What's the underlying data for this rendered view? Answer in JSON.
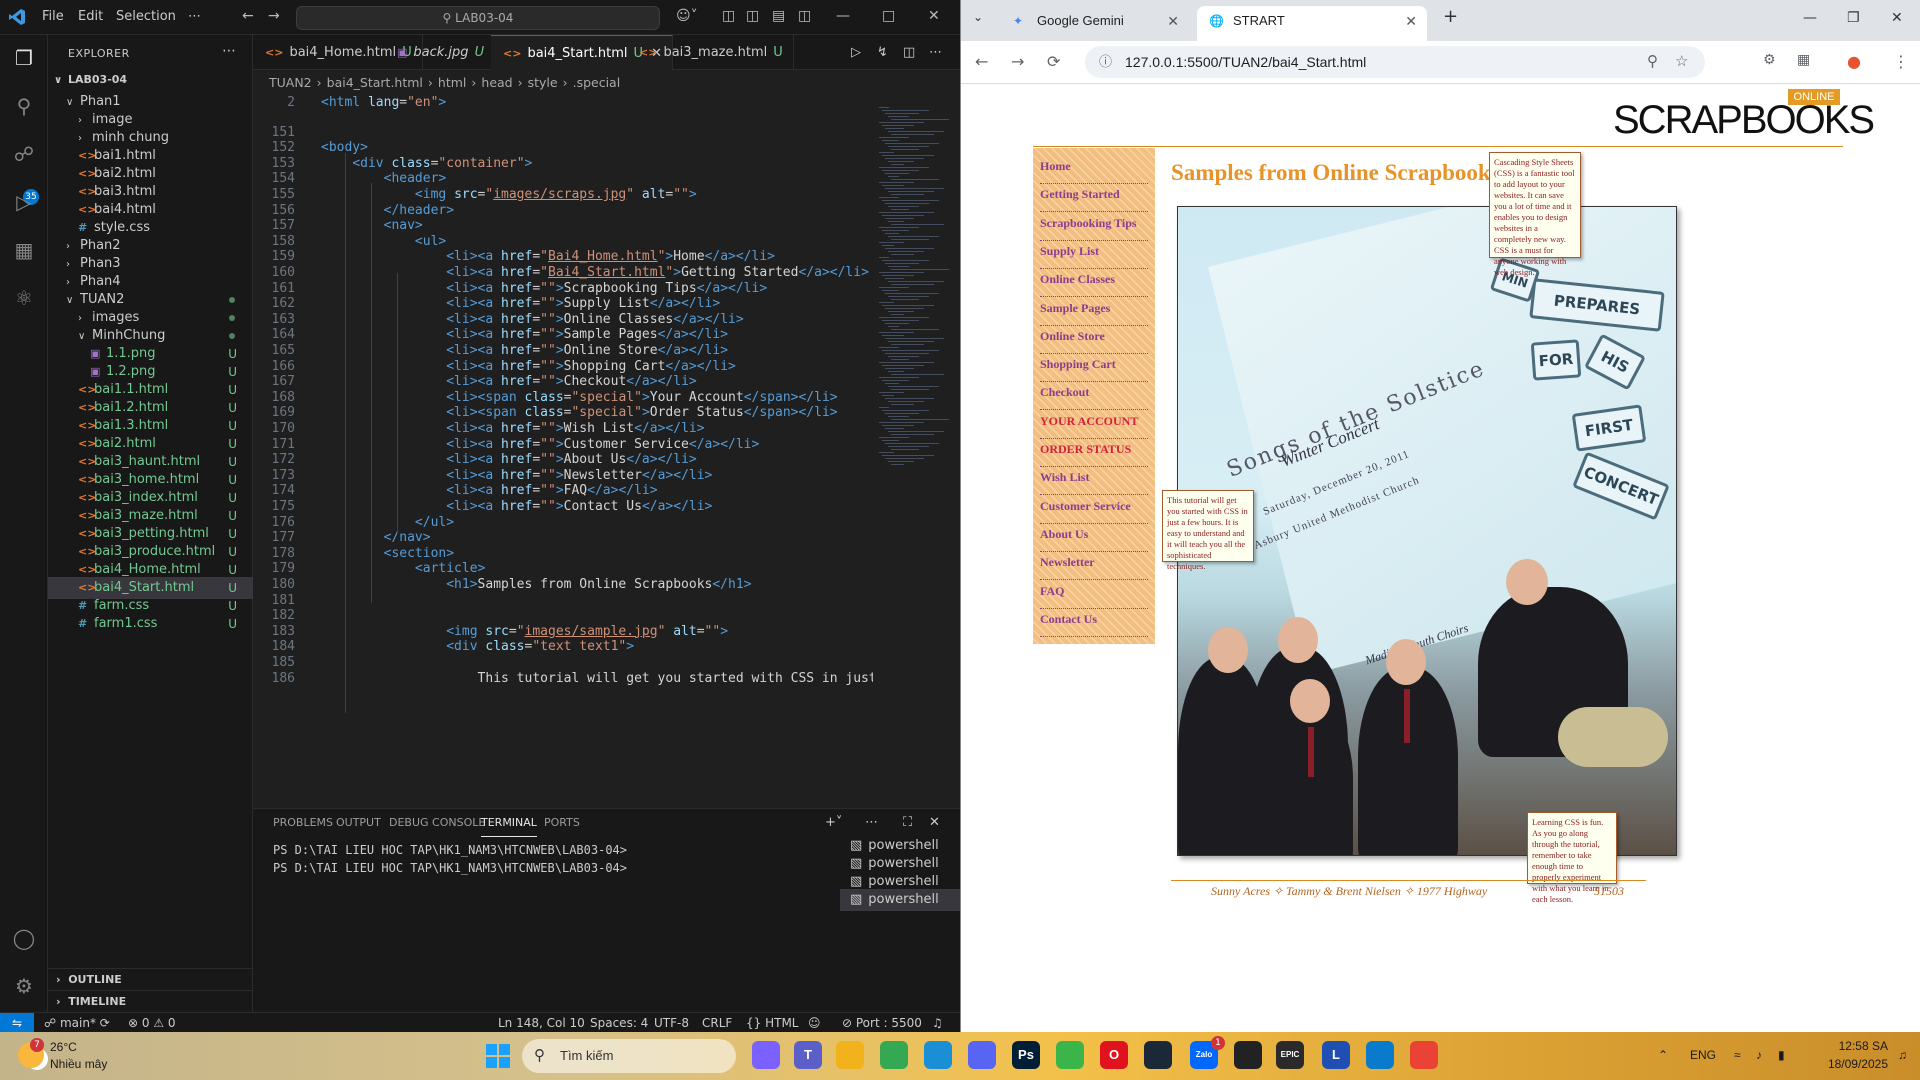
{
  "vscode": {
    "menu": [
      "File",
      "Edit",
      "Selection",
      "⋯"
    ],
    "command_center": "LAB03-04",
    "explorer": {
      "title": "EXPLORER",
      "root": "LAB03-04",
      "items": [
        {
          "label": "Phan1",
          "type": "folder-open",
          "indent": 1,
          "status": ""
        },
        {
          "label": "image",
          "type": "folder",
          "indent": 2,
          "status": ""
        },
        {
          "label": "minh chung",
          "type": "folder",
          "indent": 2,
          "status": ""
        },
        {
          "label": "bai1.html",
          "type": "html",
          "indent": 2,
          "status": ""
        },
        {
          "label": "bai2.html",
          "type": "html",
          "indent": 2,
          "status": ""
        },
        {
          "label": "bai3.html",
          "type": "html",
          "indent": 2,
          "status": ""
        },
        {
          "label": "bai4.html",
          "type": "html",
          "indent": 2,
          "status": ""
        },
        {
          "label": "style.css",
          "type": "css",
          "indent": 2,
          "status": ""
        },
        {
          "label": "Phan2",
          "type": "folder",
          "indent": 1,
          "status": ""
        },
        {
          "label": "Phan3",
          "type": "folder",
          "indent": 1,
          "status": ""
        },
        {
          "label": "Phan4",
          "type": "folder",
          "indent": 1,
          "status": ""
        },
        {
          "label": "TUAN2",
          "type": "folder-open",
          "indent": 1,
          "status": "dot"
        },
        {
          "label": "images",
          "type": "folder",
          "indent": 2,
          "status": "dot"
        },
        {
          "label": "MinhChung",
          "type": "folder-open",
          "indent": 2,
          "status": "dot"
        },
        {
          "label": "1.1.png",
          "type": "png",
          "indent": 3,
          "status": "U"
        },
        {
          "label": "1.2.png",
          "type": "png",
          "indent": 3,
          "status": "U"
        },
        {
          "label": "bai1.1.html",
          "type": "html",
          "indent": 2,
          "status": "U"
        },
        {
          "label": "bai1.2.html",
          "type": "html",
          "indent": 2,
          "status": "U"
        },
        {
          "label": "bai1.3.html",
          "type": "html",
          "indent": 2,
          "status": "U"
        },
        {
          "label": "bai2.html",
          "type": "html",
          "indent": 2,
          "status": "U"
        },
        {
          "label": "bai3_haunt.html",
          "type": "html",
          "indent": 2,
          "status": "U"
        },
        {
          "label": "bai3_home.html",
          "type": "html",
          "indent": 2,
          "status": "U"
        },
        {
          "label": "bai3_index.html",
          "type": "html",
          "indent": 2,
          "status": "U"
        },
        {
          "label": "bai3_maze.html",
          "type": "html",
          "indent": 2,
          "status": "U"
        },
        {
          "label": "bai3_petting.html",
          "type": "html",
          "indent": 2,
          "status": "U"
        },
        {
          "label": "bai3_produce.html",
          "type": "html",
          "indent": 2,
          "status": "U"
        },
        {
          "label": "bai4_Home.html",
          "type": "html",
          "indent": 2,
          "status": "U"
        },
        {
          "label": "bai4_Start.html",
          "type": "html",
          "indent": 2,
          "status": "U",
          "selected": true
        },
        {
          "label": "farm.css",
          "type": "css",
          "indent": 2,
          "status": "U"
        },
        {
          "label": "farm1.css",
          "type": "css",
          "indent": 2,
          "status": "U"
        }
      ],
      "outline": "OUTLINE",
      "timeline": "TIMELINE"
    },
    "tabs": [
      {
        "label": "bai4_Home.html",
        "type": "html",
        "status": "U",
        "italic": false,
        "active": false
      },
      {
        "label": "back.jpg",
        "type": "img",
        "status": "U",
        "italic": true,
        "active": false
      },
      {
        "label": "bai4_Start.html",
        "type": "html",
        "status": "U",
        "italic": false,
        "active": true
      },
      {
        "label": "bai3_maze.html",
        "type": "html",
        "status": "U",
        "italic": false,
        "active": false
      }
    ],
    "breadcrumb": [
      "TUAN2",
      "bai4_Start.html",
      "html",
      "head",
      "style",
      ".special"
    ],
    "code": [
      {
        "n": "2",
        "html": "<span class='tag'>&lt;html</span> <span class='attr'>lang</span>=<span class='str'>\"en\"</span><span class='tag'>&gt;</span>"
      },
      {
        "n": "151",
        "html": ""
      },
      {
        "n": "152",
        "html": "<span class='tag'>&lt;body&gt;</span>"
      },
      {
        "n": "153",
        "html": "    <span class='tag'>&lt;div</span> <span class='attr'>class</span>=<span class='str'>\"container\"</span><span class='tag'>&gt;</span>"
      },
      {
        "n": "154",
        "html": "        <span class='tag'>&lt;header&gt;</span>"
      },
      {
        "n": "155",
        "html": "            <span class='tag'>&lt;img</span> <span class='attr'>src</span>=<span class='str'>\"<u>images/scraps.jpg</u>\"</span> <span class='attr'>alt</span>=<span class='str'>\"\"</span><span class='tag'>&gt;</span>"
      },
      {
        "n": "156",
        "html": "        <span class='tag'>&lt;/header&gt;</span>"
      },
      {
        "n": "157",
        "html": "        <span class='tag'>&lt;nav&gt;</span>"
      },
      {
        "n": "158",
        "html": "            <span class='tag'>&lt;ul&gt;</span>"
      },
      {
        "n": "159",
        "html": "                <span class='tag'>&lt;li&gt;&lt;a</span> <span class='attr'>href</span>=<span class='str'>\"<u>Bai4_Home.html</u>\"</span><span class='tag'>&gt;</span><span class='txt'>Home</span><span class='tag'>&lt;/a&gt;&lt;/li&gt;</span>"
      },
      {
        "n": "160",
        "html": "                <span class='tag'>&lt;li&gt;&lt;a</span> <span class='attr'>href</span>=<span class='str'>\"<u>Bai4_Start.html</u>\"</span><span class='tag'>&gt;</span><span class='txt'>Getting Started</span><span class='tag'>&lt;/a&gt;&lt;/li&gt;</span>"
      },
      {
        "n": "161",
        "html": "                <span class='tag'>&lt;li&gt;&lt;a</span> <span class='attr'>href</span>=<span class='str'>\"\"</span><span class='tag'>&gt;</span><span class='txt'>Scrapbooking Tips</span><span class='tag'>&lt;/a&gt;&lt;/li&gt;</span>"
      },
      {
        "n": "162",
        "html": "                <span class='tag'>&lt;li&gt;&lt;a</span> <span class='attr'>href</span>=<span class='str'>\"\"</span><span class='tag'>&gt;</span><span class='txt'>Supply List</span><span class='tag'>&lt;/a&gt;&lt;/li&gt;</span>"
      },
      {
        "n": "163",
        "html": "                <span class='tag'>&lt;li&gt;&lt;a</span> <span class='attr'>href</span>=<span class='str'>\"\"</span><span class='tag'>&gt;</span><span class='txt'>Online Classes</span><span class='tag'>&lt;/a&gt;&lt;/li&gt;</span>"
      },
      {
        "n": "164",
        "html": "                <span class='tag'>&lt;li&gt;&lt;a</span> <span class='attr'>href</span>=<span class='str'>\"\"</span><span class='tag'>&gt;</span><span class='txt'>Sample Pages</span><span class='tag'>&lt;/a&gt;&lt;/li&gt;</span>"
      },
      {
        "n": "165",
        "html": "                <span class='tag'>&lt;li&gt;&lt;a</span> <span class='attr'>href</span>=<span class='str'>\"\"</span><span class='tag'>&gt;</span><span class='txt'>Online Store</span><span class='tag'>&lt;/a&gt;&lt;/li&gt;</span>"
      },
      {
        "n": "166",
        "html": "                <span class='tag'>&lt;li&gt;&lt;a</span> <span class='attr'>href</span>=<span class='str'>\"\"</span><span class='tag'>&gt;</span><span class='txt'>Shopping Cart</span><span class='tag'>&lt;/a&gt;&lt;/li&gt;</span>"
      },
      {
        "n": "167",
        "html": "                <span class='tag'>&lt;li&gt;&lt;a</span> <span class='attr'>href</span>=<span class='str'>\"\"</span><span class='tag'>&gt;</span><span class='txt'>Checkout</span><span class='tag'>&lt;/a&gt;&lt;/li&gt;</span>"
      },
      {
        "n": "168",
        "html": "                <span class='tag'>&lt;li&gt;&lt;span</span> <span class='attr'>class</span>=<span class='str'>\"special\"</span><span class='tag'>&gt;</span><span class='txt'>Your Account</span><span class='tag'>&lt;/span&gt;&lt;/li&gt;</span>"
      },
      {
        "n": "169",
        "html": "                <span class='tag'>&lt;li&gt;&lt;span</span> <span class='attr'>class</span>=<span class='str'>\"special\"</span><span class='tag'>&gt;</span><span class='txt'>Order Status</span><span class='tag'>&lt;/span&gt;&lt;/li&gt;</span>"
      },
      {
        "n": "170",
        "html": "                <span class='tag'>&lt;li&gt;&lt;a</span> <span class='attr'>href</span>=<span class='str'>\"\"</span><span class='tag'>&gt;</span><span class='txt'>Wish List</span><span class='tag'>&lt;/a&gt;&lt;/li&gt;</span>"
      },
      {
        "n": "171",
        "html": "                <span class='tag'>&lt;li&gt;&lt;a</span> <span class='attr'>href</span>=<span class='str'>\"\"</span><span class='tag'>&gt;</span><span class='txt'>Customer Service</span><span class='tag'>&lt;/a&gt;&lt;/li&gt;</span>"
      },
      {
        "n": "172",
        "html": "                <span class='tag'>&lt;li&gt;&lt;a</span> <span class='attr'>href</span>=<span class='str'>\"\"</span><span class='tag'>&gt;</span><span class='txt'>About Us</span><span class='tag'>&lt;/a&gt;&lt;/li&gt;</span>"
      },
      {
        "n": "173",
        "html": "                <span class='tag'>&lt;li&gt;&lt;a</span> <span class='attr'>href</span>=<span class='str'>\"\"</span><span class='tag'>&gt;</span><span class='txt'>Newsletter</span><span class='tag'>&lt;/a&gt;&lt;/li&gt;</span>"
      },
      {
        "n": "174",
        "html": "                <span class='tag'>&lt;li&gt;&lt;a</span> <span class='attr'>href</span>=<span class='str'>\"\"</span><span class='tag'>&gt;</span><span class='txt'>FAQ</span><span class='tag'>&lt;/a&gt;&lt;/li&gt;</span>"
      },
      {
        "n": "175",
        "html": "                <span class='tag'>&lt;li&gt;&lt;a</span> <span class='attr'>href</span>=<span class='str'>\"\"</span><span class='tag'>&gt;</span><span class='txt'>Contact Us</span><span class='tag'>&lt;/a&gt;&lt;/li&gt;</span>"
      },
      {
        "n": "176",
        "html": "            <span class='tag'>&lt;/ul&gt;</span>"
      },
      {
        "n": "177",
        "html": "        <span class='tag'>&lt;/nav&gt;</span>"
      },
      {
        "n": "178",
        "html": "        <span class='tag'>&lt;section&gt;</span>"
      },
      {
        "n": "179",
        "html": "            <span class='tag'>&lt;article&gt;</span>"
      },
      {
        "n": "180",
        "html": "                <span class='tag'>&lt;h1&gt;</span><span class='txt'>Samples from Online Scrapbooks</span><span class='tag'>&lt;/h1&gt;</span>"
      },
      {
        "n": "181",
        "html": ""
      },
      {
        "n": "182",
        "html": ""
      },
      {
        "n": "183",
        "html": "                <span class='tag'>&lt;img</span> <span class='attr'>src</span>=<span class='str'>\"<u>images/sample.jpg</u>\"</span> <span class='attr'>alt</span>=<span class='str'>\"\"</span><span class='tag'>&gt;</span>"
      },
      {
        "n": "184",
        "html": "                <span class='tag'>&lt;div</span> <span class='attr'>class</span>=<span class='str'>\"text text1\"</span><span class='tag'>&gt;</span>"
      },
      {
        "n": "185",
        "html": ""
      },
      {
        "n": "186",
        "html": "                    <span class='txt'>This tutorial will get you started with CSS in just</span>"
      }
    ],
    "panel": {
      "tabs": [
        "PROBLEMS",
        "OUTPUT",
        "DEBUG CONSOLE",
        "TERMINAL",
        "PORTS"
      ],
      "active_tab": "TERMINAL",
      "terminal_lines": [
        "PS D:\\TAI LIEU HOC TAP\\HK1_NAM3\\HTCNWEB\\LAB03-04>",
        "PS D:\\TAI LIEU HOC TAP\\HK1_NAM3\\HTCNWEB\\LAB03-04>"
      ],
      "terminals": [
        "powershell",
        "powershell",
        "powershell",
        "powershell"
      ]
    },
    "status": {
      "branch": "main*",
      "problems": "⊗ 0 ⚠ 0",
      "position": "Ln 148, Col 10",
      "spaces": "Spaces: 4",
      "encoding": "UTF-8",
      "eol": "CRLF",
      "language": "HTML",
      "port": "Port : 5500"
    }
  },
  "browser": {
    "tabs": [
      {
        "label": "Google Gemini",
        "active": false
      },
      {
        "label": "STRART",
        "active": true
      }
    ],
    "url": "127.0.0.1:5500/TUAN2/bai4_Start.html",
    "page": {
      "badge": "ONLINE",
      "logo": "SCRAPBOOKS",
      "nav": [
        "Home",
        "Getting Started",
        "Scrapbooking Tips",
        "Supply List",
        "Online Classes",
        "Sample Pages",
        "Online Store",
        "Shopping Cart",
        "Checkout",
        "YOUR ACCOUNT",
        "ORDER STATUS",
        "Wish List",
        "Customer Service",
        "About Us",
        "Newsletter",
        "FAQ",
        "Contact Us"
      ],
      "heading": "Samples from Online Scrapbooks",
      "image_text": {
        "line1": "Songs of the Solstice",
        "line2": "Winter Concert",
        "line3": "Saturday, December 20, 2011",
        "line4": "Asbury United Methodist Church",
        "line5": "Madison Youth Choirs",
        "tiles": [
          "PREPARES",
          "FOR",
          "HIS",
          "FIRST",
          "CONCERT",
          "MIN"
        ]
      },
      "tooltip1": "Cascading Style Sheets (CSS) is a fantastic tool to add layout to your websites. It can save you a lot of time and it enables you to design websites in a completely new way. CSS is a must for anyone working with web design.",
      "tooltip2": "This tutorial will get you started with CSS in just a few hours. It is easy to understand and it will teach you all the sophisticated techniques.",
      "tooltip3": "Learning CSS is fun. As you go along through the tutorial, remember to take enough time to properly experiment with what you learn in each lesson.",
      "footer": "Sunny Acres ✧ Tammy & Brent Nielsen ✧ 1977 Highway",
      "footer_tail": "51503"
    }
  },
  "taskbar": {
    "weather_temp": "26°C",
    "weather_desc": "Nhiều mây",
    "weather_badge": "7",
    "search": "Tìm kiếm",
    "apps": [
      {
        "name": "copilot",
        "label": "",
        "color": "#7b61ff"
      },
      {
        "name": "teams",
        "label": "T",
        "color": "#5b5fc7"
      },
      {
        "name": "file-explorer",
        "label": "",
        "color": "#f2b21b"
      },
      {
        "name": "chrome",
        "label": "",
        "color": "#34a853"
      },
      {
        "name": "edge",
        "label": "",
        "color": "#1a8fd6"
      },
      {
        "name": "discord",
        "label": "",
        "color": "#5865f2"
      },
      {
        "name": "photoshop",
        "label": "Ps",
        "color": "#001e36"
      },
      {
        "name": "app-green",
        "label": "",
        "color": "#3bb54a"
      },
      {
        "name": "opera",
        "label": "O",
        "color": "#e0121e"
      },
      {
        "name": "steam",
        "label": "",
        "color": "#1b2838"
      },
      {
        "name": "zalo",
        "label": "Zalo",
        "color": "#0068ff"
      },
      {
        "name": "game-red",
        "label": "",
        "color": "#222"
      },
      {
        "name": "epic-games",
        "label": "EPIC",
        "color": "#2a2a2a"
      },
      {
        "name": "app-l",
        "label": "L",
        "color": "#1f4fb3"
      },
      {
        "name": "vscode",
        "label": "",
        "color": "#0a7acc"
      },
      {
        "name": "chrome-2",
        "label": "",
        "color": "#ea4335"
      }
    ],
    "zalo_badge": "1",
    "lang": "ENG",
    "time": "12:58 SA",
    "date": "18/09/2025"
  }
}
